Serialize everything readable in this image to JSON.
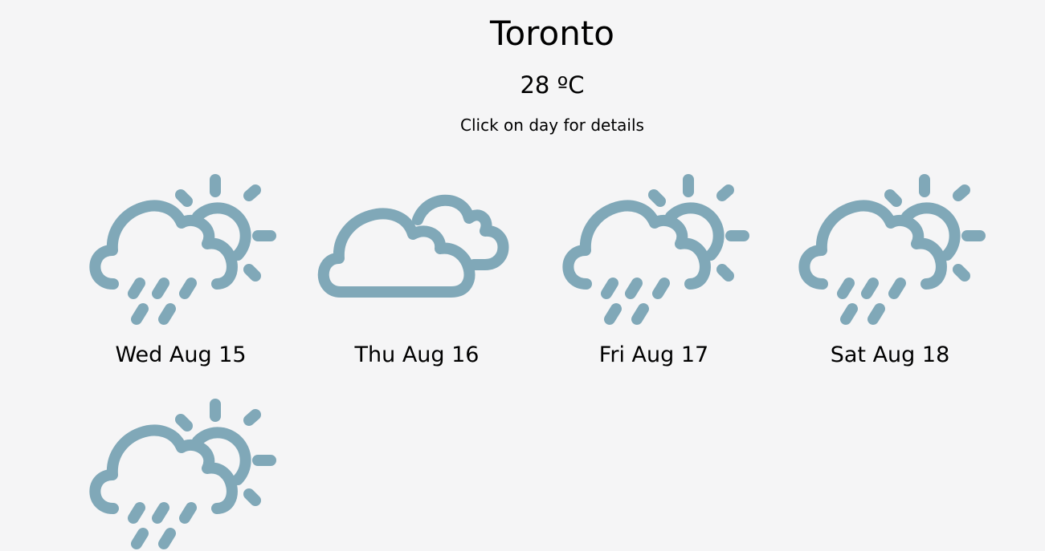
{
  "location": {
    "city": "Toronto",
    "temperature": "28 ºC",
    "hint": "Click on day for details"
  },
  "colors": {
    "icon": "#80a8b8",
    "background": "#f5f5f6"
  },
  "forecast": [
    {
      "label": "Wed Aug 15",
      "icon": "rain-sun-icon"
    },
    {
      "label": "Thu Aug 16",
      "icon": "cloudy-icon"
    },
    {
      "label": "Fri Aug 17",
      "icon": "rain-sun-icon"
    },
    {
      "label": "Sat Aug 18",
      "icon": "rain-sun-icon"
    },
    {
      "label": "",
      "icon": "rain-sun-icon"
    }
  ]
}
